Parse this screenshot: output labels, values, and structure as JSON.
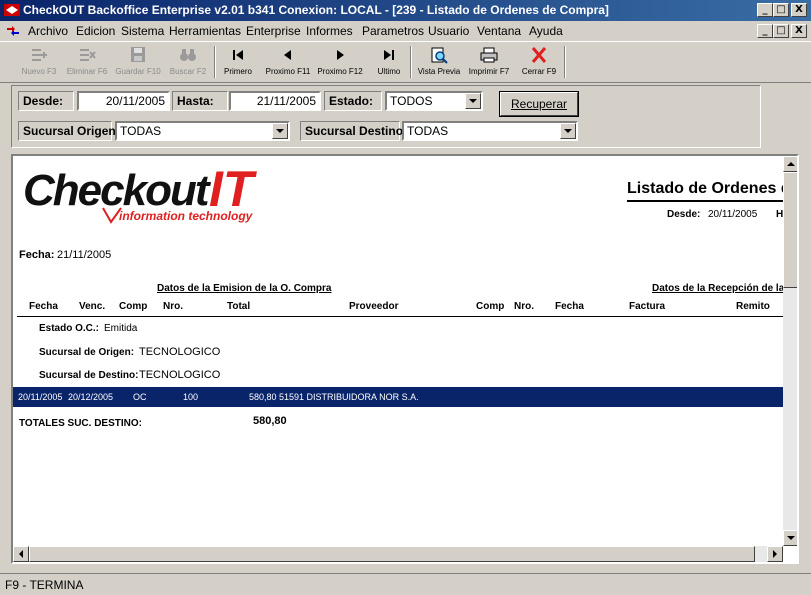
{
  "window": {
    "title": "CheckOUT Backoffice Enterprise v2.01 b341 Conexion: LOCAL - [239 - Listado de Ordenes de Compra]",
    "minimize": "_",
    "maximize": "□",
    "close": "X",
    "restore": "🗗"
  },
  "menu": [
    "Archivo",
    "Edicion",
    "Sistema",
    "Herramientas",
    "Enterprise",
    "Informes",
    "Parametros",
    "Usuario",
    "Ventana",
    "Ayuda"
  ],
  "toolbar": {
    "nuevo": "Nuevo F3",
    "eliminar": "Eliminar F6",
    "guardar": "Guardar F10",
    "buscar": "Buscar F2",
    "primero": "Primero",
    "proximo_f11": "Proximo F11",
    "proximo_f12": "Proximo F12",
    "ultimo": "Ultimo",
    "vista_previa": "Vista Previa",
    "imprimir": "Imprimir F7",
    "cerrar": "Cerrar F9"
  },
  "filters": {
    "desde_label": "Desde:",
    "desde_value": "20/11/2005",
    "hasta_label": "Hasta:",
    "hasta_value": "21/11/2005",
    "estado_label": "Estado:",
    "estado_value": "TODOS",
    "recuperar": "Recuperar",
    "sucursal_origen_label": "Sucursal Origen:",
    "sucursal_origen_value": "TODAS",
    "sucursal_destino_label": "Sucursal Destino:",
    "sucursal_destino_value": "TODAS"
  },
  "report": {
    "logo_checkout": "Checkout",
    "logo_it": "IT",
    "logo_tagline": "information technology",
    "title": "Listado de Ordenes d",
    "desde_label": "Desde:",
    "desde_value": "20/11/2005",
    "hasta_cut": "H",
    "fecha_label": "Fecha:",
    "fecha_value": "21/11/2005",
    "section_emision": "Datos de la Emision de la O. Compra",
    "section_recepcion": "Datos de la Recepción de la",
    "columns": {
      "fecha": "Fecha",
      "venc": "Venc.",
      "comp": "Comp",
      "nro": "Nro.",
      "total": "Total",
      "proveedor": "Proveedor",
      "comp2": "Comp",
      "nro2": "Nro.",
      "fecha2": "Fecha",
      "factura": "Factura",
      "remito": "Remito"
    },
    "estado_label": "Estado O.C.:",
    "estado_value": "Emitida",
    "origen_label": "Sucursal de Origen:",
    "origen_value": "TECNOLOGICO",
    "destino_label": "Sucursal de Destino:",
    "destino_value": "TECNOLOGICO",
    "row": {
      "fecha": "20/11/2005",
      "venc": "20/12/2005",
      "comp": "OC",
      "nro": "100",
      "total_proveedor": "580,80 51591 DISTRIBUIDORA NOR S.A."
    },
    "totales_label": "TOTALES SUC. DESTINO:",
    "totales_value": "580,80"
  },
  "status": {
    "text": "F9 - TERMINA"
  },
  "colors": {
    "title_gradient_start": "#0a246a",
    "selected_row": "#0a246a",
    "logo_red": "#e02020"
  }
}
